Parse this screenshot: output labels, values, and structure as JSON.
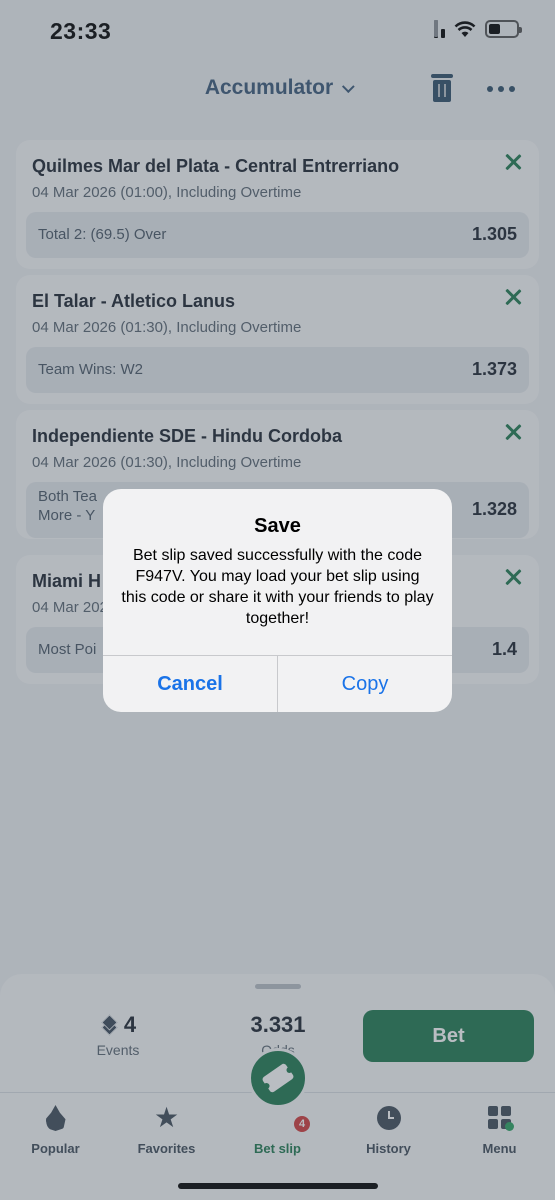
{
  "status_bar": {
    "time": "23:33"
  },
  "header": {
    "title": "Accumulator"
  },
  "bets": [
    {
      "match": "Quilmes Mar del Plata - Central Entrerriano",
      "datetime": "04 Mar 2026 (01:00), Including Overtime",
      "market": "Total 2: (69.5) Over",
      "odd": "1.305"
    },
    {
      "match": "El Talar - Atletico Lanus",
      "datetime": "04 Mar 2026 (01:30), Including Overtime",
      "market": "Team Wins: W2",
      "odd": "1.373"
    },
    {
      "match": "Independiente SDE - Hindu Cordoba",
      "datetime": "04 Mar 2026 (01:30), Including Overtime",
      "market": "Both Tea\nMore - Y",
      "odd": "1.328"
    },
    {
      "match": "Miami H",
      "datetime": "04 Mar 2026",
      "market": "Most Poi",
      "odd": "1.4"
    }
  ],
  "summary": {
    "events_value": "4",
    "events_label": "Events",
    "odds_value": "3.331",
    "odds_label": "Odds",
    "bet_label": "Bet"
  },
  "tabs": [
    {
      "label": "Popular",
      "icon": "flame-icon"
    },
    {
      "label": "Favorites",
      "icon": "star-icon"
    },
    {
      "label": "Bet slip",
      "icon": "ticket-icon"
    },
    {
      "label": "History",
      "icon": "clock-icon"
    },
    {
      "label": "Menu",
      "icon": "grid-icon"
    }
  ],
  "betslip_badge": "4",
  "dialog": {
    "title": "Save",
    "message": "Bet slip saved successfully with the code F947V. You may load your bet slip using this code or share it with your friends to play together!",
    "cancel_label": "Cancel",
    "copy_label": "Copy"
  },
  "colors": {
    "accent": "#1f7a4f",
    "dialog_button": "#1a73e8",
    "badge": "#d23a3a"
  }
}
